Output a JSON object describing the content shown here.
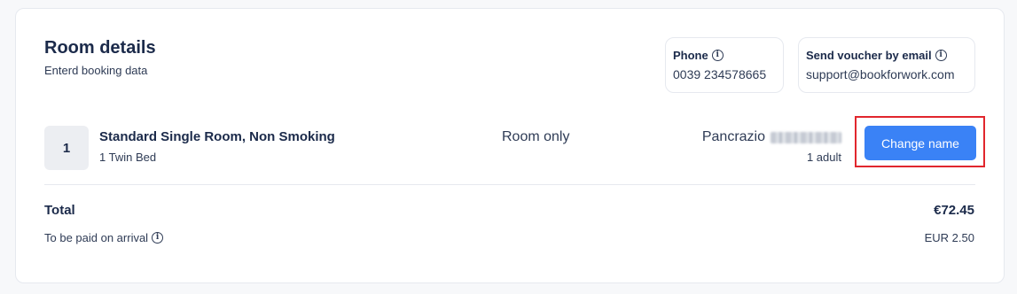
{
  "header": {
    "title": "Room details",
    "subtitle": "Enterd booking data"
  },
  "contact": {
    "phone": {
      "label": "Phone",
      "value": "0039 234578665",
      "icon": "info-icon"
    },
    "email": {
      "label": "Send voucher by email",
      "value": "support@bookforwork.com",
      "icon": "info-icon"
    }
  },
  "room": {
    "number": "1",
    "name": "Standard Single Room, Non Smoking",
    "bed": "1 Twin Bed",
    "board": "Room only",
    "guest_first_name": "Pancrazio",
    "guest_last_name_redacted": true,
    "occupancy": "1 adult",
    "change_name_label": "Change name"
  },
  "summary": {
    "total_label": "Total",
    "total_value": "€72.45",
    "pay_label": "To be paid on arrival",
    "pay_value": "EUR 2.50"
  },
  "colors": {
    "primary_button": "#3a82f6",
    "highlight_border": "#e1262d",
    "text_dark": "#1b2a4a"
  }
}
